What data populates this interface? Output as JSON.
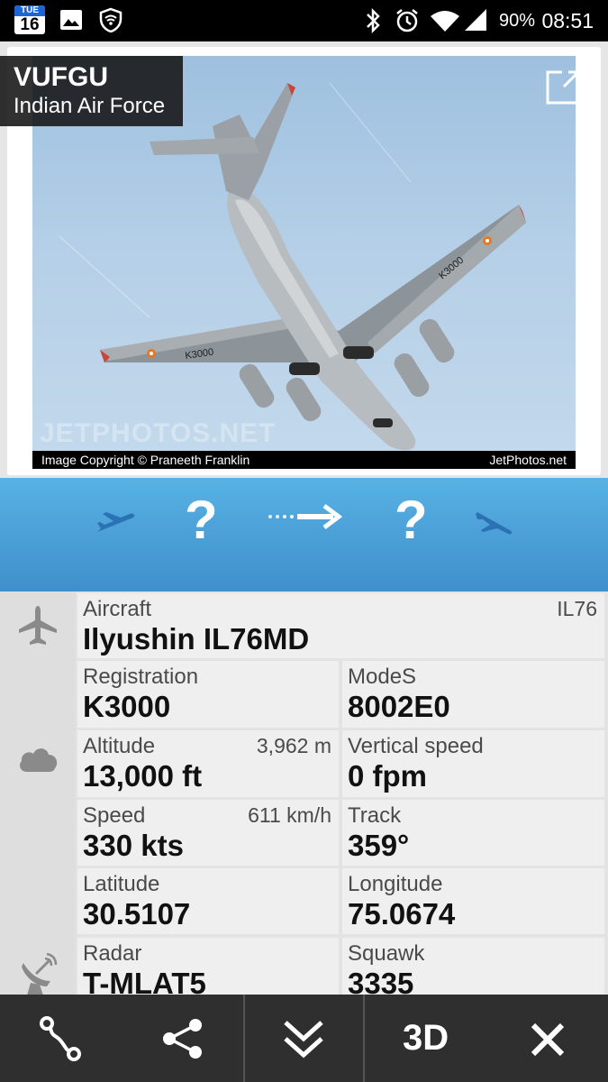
{
  "status_bar": {
    "calendar_day": "TUE",
    "calendar_date": "16",
    "battery": "90%",
    "time": "08:51",
    "icons": [
      "calendar-icon",
      "image-icon",
      "shield-wifi-icon",
      "bluetooth-icon",
      "alarm-icon",
      "wifi-icon",
      "cell-signal-icon",
      "battery-icon"
    ]
  },
  "photo": {
    "registration": "VUFGU",
    "operator": "Indian Air Force",
    "watermark": "JETPHOTOS.NET",
    "copyright": "Image Copyright © Praneeth Franklin",
    "source": "JetPhotos.net",
    "aircraft_marking": "K3000"
  },
  "route": {
    "origin": "?",
    "destination": "?",
    "icons": [
      "takeoff-icon",
      "arrow-right-icon",
      "landing-icon"
    ]
  },
  "details": {
    "aircraft_label": "Aircraft",
    "aircraft_code": "IL76",
    "aircraft_value": "Ilyushin IL76MD",
    "registration_label": "Registration",
    "registration_value": "K3000",
    "modes_label": "ModeS",
    "modes_value": "8002E0",
    "altitude_label": "Altitude",
    "altitude_metric": "3,962 m",
    "altitude_value": "13,000 ft",
    "vspeed_label": "Vertical speed",
    "vspeed_value": "0 fpm",
    "speed_label": "Speed",
    "speed_metric": "611 km/h",
    "speed_value": "330 kts",
    "track_label": "Track",
    "track_value": "359°",
    "latitude_label": "Latitude",
    "latitude_value": "30.5107",
    "longitude_label": "Longitude",
    "longitude_value": "75.0674",
    "radar_label": "Radar",
    "radar_value": "T-MLAT5",
    "squawk_label": "Squawk",
    "squawk_value": "3335"
  },
  "bottom_bar": {
    "three_d_label": "3D",
    "icons": [
      "route-icon",
      "share-icon",
      "expand-down-icon",
      "3d-view",
      "close-icon"
    ]
  },
  "colors": {
    "route_bar_top": "#58b2e4",
    "route_bar_bottom": "#3f8fcb",
    "bottom_bar": "#2f2f2f"
  }
}
